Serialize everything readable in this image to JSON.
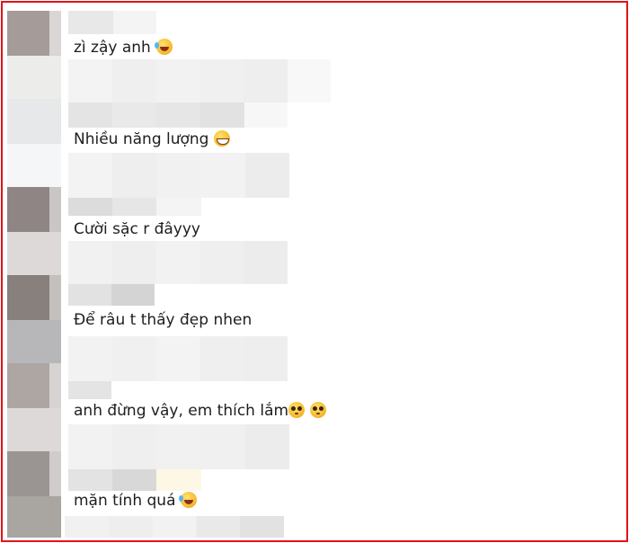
{
  "comments": [
    {
      "text": "zì zậy anh",
      "emoji": [
        "rolling-on-floor-laughing-icon"
      ]
    },
    {
      "text": "Nhiều năng lượng",
      "emoji": [
        "grinning-face-icon"
      ]
    },
    {
      "text": "Cười sặc r đâyyy",
      "emoji": []
    },
    {
      "text": "Để râu t thấy đẹp nhen",
      "emoji": []
    },
    {
      "text": "anh đừng vậy, em thích lắm",
      "emoji": [
        "pleading-face-icon",
        "pleading-face-icon"
      ]
    },
    {
      "text": "mặn tính quá",
      "emoji": [
        "rolling-on-floor-laughing-icon"
      ]
    }
  ],
  "colors": {
    "frame_border": "#e3121c",
    "text": "#1c1e21",
    "blur_light": "#f0f0f0",
    "blur_mid": "#e4e4e4"
  }
}
